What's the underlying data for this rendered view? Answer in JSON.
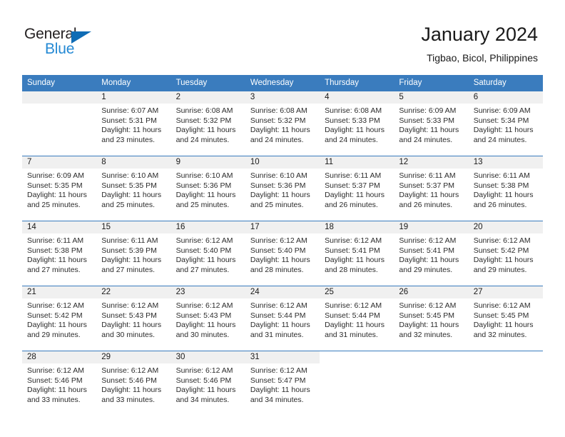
{
  "brand": {
    "name_part1": "General",
    "name_part2": "Blue",
    "triangle_color": "#0f6cb5",
    "blue_color": "#2489d4"
  },
  "header": {
    "title": "January 2024",
    "subtitle": "Tigbao, Bicol, Philippines"
  },
  "theme": {
    "header_bg": "#3a7cbe",
    "daynum_bg": "#f0f0f0",
    "grid_line": "#3a7cbe",
    "text": "#1a1a1a"
  },
  "weekdays": [
    "Sunday",
    "Monday",
    "Tuesday",
    "Wednesday",
    "Thursday",
    "Friday",
    "Saturday"
  ],
  "weeks": [
    [
      {
        "day": "",
        "sunrise": "",
        "sunset": "",
        "daylight_l1": "",
        "daylight_l2": ""
      },
      {
        "day": "1",
        "sunrise": "Sunrise: 6:07 AM",
        "sunset": "Sunset: 5:31 PM",
        "daylight_l1": "Daylight: 11 hours",
        "daylight_l2": "and 23 minutes."
      },
      {
        "day": "2",
        "sunrise": "Sunrise: 6:08 AM",
        "sunset": "Sunset: 5:32 PM",
        "daylight_l1": "Daylight: 11 hours",
        "daylight_l2": "and 24 minutes."
      },
      {
        "day": "3",
        "sunrise": "Sunrise: 6:08 AM",
        "sunset": "Sunset: 5:32 PM",
        "daylight_l1": "Daylight: 11 hours",
        "daylight_l2": "and 24 minutes."
      },
      {
        "day": "4",
        "sunrise": "Sunrise: 6:08 AM",
        "sunset": "Sunset: 5:33 PM",
        "daylight_l1": "Daylight: 11 hours",
        "daylight_l2": "and 24 minutes."
      },
      {
        "day": "5",
        "sunrise": "Sunrise: 6:09 AM",
        "sunset": "Sunset: 5:33 PM",
        "daylight_l1": "Daylight: 11 hours",
        "daylight_l2": "and 24 minutes."
      },
      {
        "day": "6",
        "sunrise": "Sunrise: 6:09 AM",
        "sunset": "Sunset: 5:34 PM",
        "daylight_l1": "Daylight: 11 hours",
        "daylight_l2": "and 24 minutes."
      }
    ],
    [
      {
        "day": "7",
        "sunrise": "Sunrise: 6:09 AM",
        "sunset": "Sunset: 5:35 PM",
        "daylight_l1": "Daylight: 11 hours",
        "daylight_l2": "and 25 minutes."
      },
      {
        "day": "8",
        "sunrise": "Sunrise: 6:10 AM",
        "sunset": "Sunset: 5:35 PM",
        "daylight_l1": "Daylight: 11 hours",
        "daylight_l2": "and 25 minutes."
      },
      {
        "day": "9",
        "sunrise": "Sunrise: 6:10 AM",
        "sunset": "Sunset: 5:36 PM",
        "daylight_l1": "Daylight: 11 hours",
        "daylight_l2": "and 25 minutes."
      },
      {
        "day": "10",
        "sunrise": "Sunrise: 6:10 AM",
        "sunset": "Sunset: 5:36 PM",
        "daylight_l1": "Daylight: 11 hours",
        "daylight_l2": "and 25 minutes."
      },
      {
        "day": "11",
        "sunrise": "Sunrise: 6:11 AM",
        "sunset": "Sunset: 5:37 PM",
        "daylight_l1": "Daylight: 11 hours",
        "daylight_l2": "and 26 minutes."
      },
      {
        "day": "12",
        "sunrise": "Sunrise: 6:11 AM",
        "sunset": "Sunset: 5:37 PM",
        "daylight_l1": "Daylight: 11 hours",
        "daylight_l2": "and 26 minutes."
      },
      {
        "day": "13",
        "sunrise": "Sunrise: 6:11 AM",
        "sunset": "Sunset: 5:38 PM",
        "daylight_l1": "Daylight: 11 hours",
        "daylight_l2": "and 26 minutes."
      }
    ],
    [
      {
        "day": "14",
        "sunrise": "Sunrise: 6:11 AM",
        "sunset": "Sunset: 5:38 PM",
        "daylight_l1": "Daylight: 11 hours",
        "daylight_l2": "and 27 minutes."
      },
      {
        "day": "15",
        "sunrise": "Sunrise: 6:11 AM",
        "sunset": "Sunset: 5:39 PM",
        "daylight_l1": "Daylight: 11 hours",
        "daylight_l2": "and 27 minutes."
      },
      {
        "day": "16",
        "sunrise": "Sunrise: 6:12 AM",
        "sunset": "Sunset: 5:40 PM",
        "daylight_l1": "Daylight: 11 hours",
        "daylight_l2": "and 27 minutes."
      },
      {
        "day": "17",
        "sunrise": "Sunrise: 6:12 AM",
        "sunset": "Sunset: 5:40 PM",
        "daylight_l1": "Daylight: 11 hours",
        "daylight_l2": "and 28 minutes."
      },
      {
        "day": "18",
        "sunrise": "Sunrise: 6:12 AM",
        "sunset": "Sunset: 5:41 PM",
        "daylight_l1": "Daylight: 11 hours",
        "daylight_l2": "and 28 minutes."
      },
      {
        "day": "19",
        "sunrise": "Sunrise: 6:12 AM",
        "sunset": "Sunset: 5:41 PM",
        "daylight_l1": "Daylight: 11 hours",
        "daylight_l2": "and 29 minutes."
      },
      {
        "day": "20",
        "sunrise": "Sunrise: 6:12 AM",
        "sunset": "Sunset: 5:42 PM",
        "daylight_l1": "Daylight: 11 hours",
        "daylight_l2": "and 29 minutes."
      }
    ],
    [
      {
        "day": "21",
        "sunrise": "Sunrise: 6:12 AM",
        "sunset": "Sunset: 5:42 PM",
        "daylight_l1": "Daylight: 11 hours",
        "daylight_l2": "and 29 minutes."
      },
      {
        "day": "22",
        "sunrise": "Sunrise: 6:12 AM",
        "sunset": "Sunset: 5:43 PM",
        "daylight_l1": "Daylight: 11 hours",
        "daylight_l2": "and 30 minutes."
      },
      {
        "day": "23",
        "sunrise": "Sunrise: 6:12 AM",
        "sunset": "Sunset: 5:43 PM",
        "daylight_l1": "Daylight: 11 hours",
        "daylight_l2": "and 30 minutes."
      },
      {
        "day": "24",
        "sunrise": "Sunrise: 6:12 AM",
        "sunset": "Sunset: 5:44 PM",
        "daylight_l1": "Daylight: 11 hours",
        "daylight_l2": "and 31 minutes."
      },
      {
        "day": "25",
        "sunrise": "Sunrise: 6:12 AM",
        "sunset": "Sunset: 5:44 PM",
        "daylight_l1": "Daylight: 11 hours",
        "daylight_l2": "and 31 minutes."
      },
      {
        "day": "26",
        "sunrise": "Sunrise: 6:12 AM",
        "sunset": "Sunset: 5:45 PM",
        "daylight_l1": "Daylight: 11 hours",
        "daylight_l2": "and 32 minutes."
      },
      {
        "day": "27",
        "sunrise": "Sunrise: 6:12 AM",
        "sunset": "Sunset: 5:45 PM",
        "daylight_l1": "Daylight: 11 hours",
        "daylight_l2": "and 32 minutes."
      }
    ],
    [
      {
        "day": "28",
        "sunrise": "Sunrise: 6:12 AM",
        "sunset": "Sunset: 5:46 PM",
        "daylight_l1": "Daylight: 11 hours",
        "daylight_l2": "and 33 minutes."
      },
      {
        "day": "29",
        "sunrise": "Sunrise: 6:12 AM",
        "sunset": "Sunset: 5:46 PM",
        "daylight_l1": "Daylight: 11 hours",
        "daylight_l2": "and 33 minutes."
      },
      {
        "day": "30",
        "sunrise": "Sunrise: 6:12 AM",
        "sunset": "Sunset: 5:46 PM",
        "daylight_l1": "Daylight: 11 hours",
        "daylight_l2": "and 34 minutes."
      },
      {
        "day": "31",
        "sunrise": "Sunrise: 6:12 AM",
        "sunset": "Sunset: 5:47 PM",
        "daylight_l1": "Daylight: 11 hours",
        "daylight_l2": "and 34 minutes."
      },
      {
        "day": "",
        "sunrise": "",
        "sunset": "",
        "daylight_l1": "",
        "daylight_l2": ""
      },
      {
        "day": "",
        "sunrise": "",
        "sunset": "",
        "daylight_l1": "",
        "daylight_l2": ""
      },
      {
        "day": "",
        "sunrise": "",
        "sunset": "",
        "daylight_l1": "",
        "daylight_l2": ""
      }
    ]
  ]
}
